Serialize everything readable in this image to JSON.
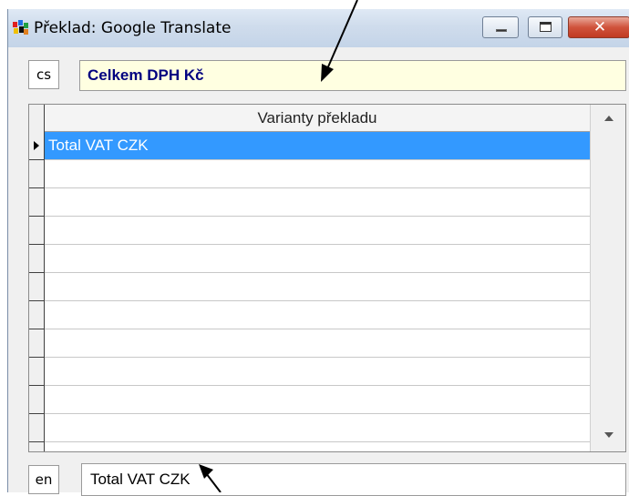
{
  "window": {
    "title": "Překlad:  Google Translate",
    "app_icon": "google-translate-app-icon",
    "controls": {
      "minimize": "minimize-icon",
      "maximize": "maximize-icon",
      "close": "close-icon"
    }
  },
  "source": {
    "lang": "cs",
    "text": "Celkem DPH Kč",
    "bg_color": "#ffffe1",
    "text_color": "#000080"
  },
  "grid": {
    "column_header": "Varianty překladu",
    "rows": [
      {
        "text": "Total VAT CZK",
        "selected": true
      }
    ],
    "selection_color": "#3399ff"
  },
  "target": {
    "lang": "en",
    "text": "Total VAT CZK"
  }
}
